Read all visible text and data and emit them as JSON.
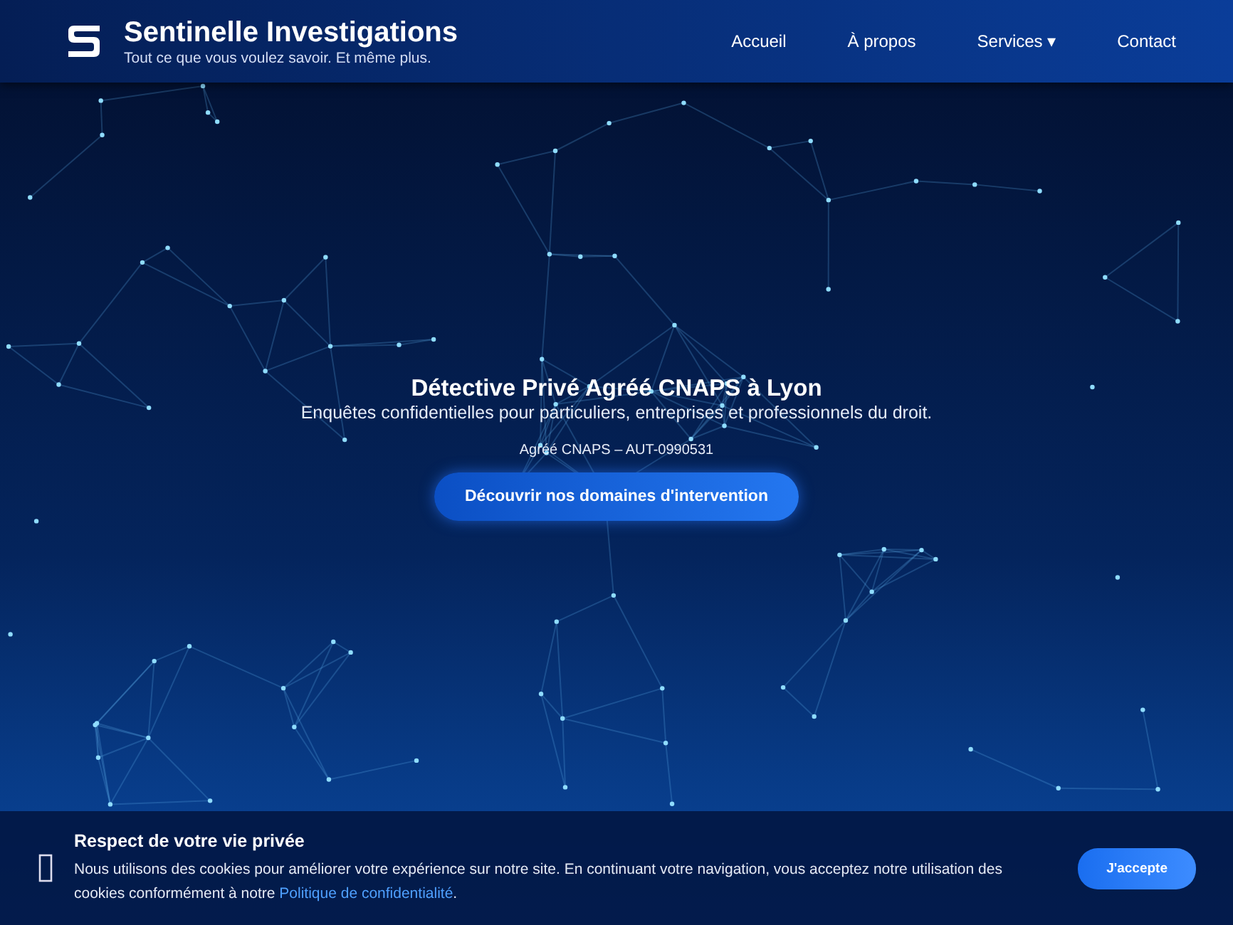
{
  "header": {
    "title": "Sentinelle Investigations",
    "tagline": "Tout ce que vous voulez savoir. Et même plus.",
    "nav": [
      {
        "label": "Accueil",
        "kind": "link"
      },
      {
        "label": "À propos",
        "kind": "link"
      },
      {
        "label": "Services",
        "kind": "dropdown",
        "caret": "▾"
      },
      {
        "label": "Contact",
        "kind": "link"
      }
    ]
  },
  "hero": {
    "title": "Détective Privé Agréé CNAPS à Lyon",
    "subtitle": "Enquêtes confidentielles pour particuliers, entreprises et professionnels du droit.",
    "license": "Agréé CNAPS – AUT-0990531",
    "button": "Découvrir nos domaines d'intervention"
  },
  "cookie_banner": {
    "title": "Respect de votre vie privée",
    "text": "Nous utilisons des cookies pour améliorer votre expérience sur notre site. En continuant votre navigation, vous acceptez notre utilisation des cookies conformément à notre ",
    "link": "Politique de confidentialité",
    "text_end": ".",
    "button": "J'accepte"
  }
}
